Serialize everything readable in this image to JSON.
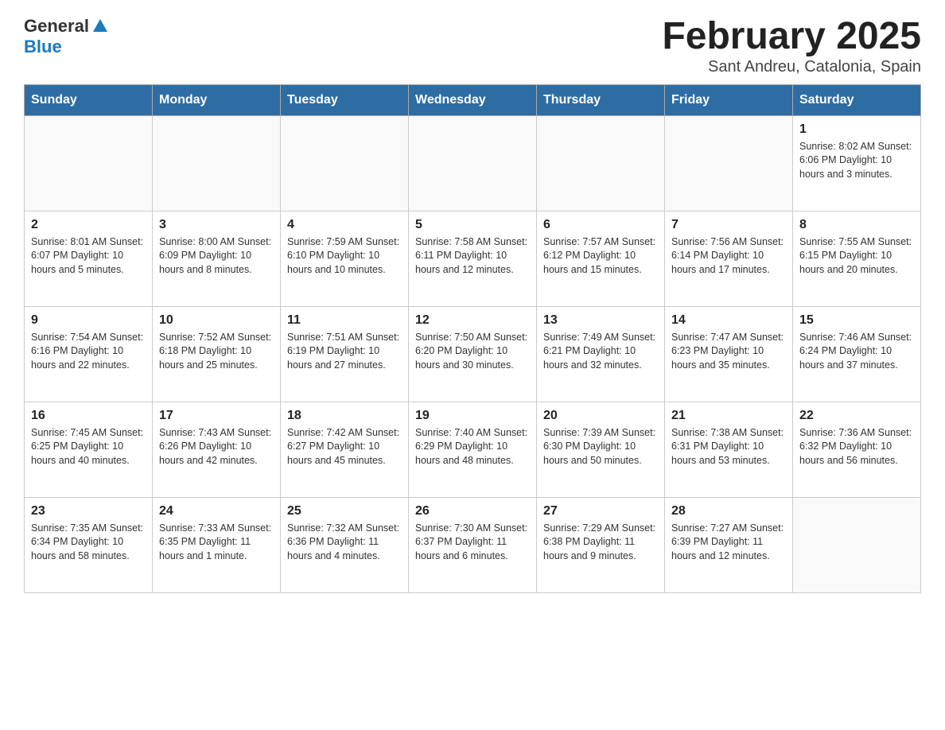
{
  "header": {
    "logo_general": "General",
    "logo_blue": "Blue",
    "title": "February 2025",
    "subtitle": "Sant Andreu, Catalonia, Spain"
  },
  "days_of_week": [
    "Sunday",
    "Monday",
    "Tuesday",
    "Wednesday",
    "Thursday",
    "Friday",
    "Saturday"
  ],
  "weeks": [
    [
      {
        "day": "",
        "info": ""
      },
      {
        "day": "",
        "info": ""
      },
      {
        "day": "",
        "info": ""
      },
      {
        "day": "",
        "info": ""
      },
      {
        "day": "",
        "info": ""
      },
      {
        "day": "",
        "info": ""
      },
      {
        "day": "1",
        "info": "Sunrise: 8:02 AM\nSunset: 6:06 PM\nDaylight: 10 hours\nand 3 minutes."
      }
    ],
    [
      {
        "day": "2",
        "info": "Sunrise: 8:01 AM\nSunset: 6:07 PM\nDaylight: 10 hours\nand 5 minutes."
      },
      {
        "day": "3",
        "info": "Sunrise: 8:00 AM\nSunset: 6:09 PM\nDaylight: 10 hours\nand 8 minutes."
      },
      {
        "day": "4",
        "info": "Sunrise: 7:59 AM\nSunset: 6:10 PM\nDaylight: 10 hours\nand 10 minutes."
      },
      {
        "day": "5",
        "info": "Sunrise: 7:58 AM\nSunset: 6:11 PM\nDaylight: 10 hours\nand 12 minutes."
      },
      {
        "day": "6",
        "info": "Sunrise: 7:57 AM\nSunset: 6:12 PM\nDaylight: 10 hours\nand 15 minutes."
      },
      {
        "day": "7",
        "info": "Sunrise: 7:56 AM\nSunset: 6:14 PM\nDaylight: 10 hours\nand 17 minutes."
      },
      {
        "day": "8",
        "info": "Sunrise: 7:55 AM\nSunset: 6:15 PM\nDaylight: 10 hours\nand 20 minutes."
      }
    ],
    [
      {
        "day": "9",
        "info": "Sunrise: 7:54 AM\nSunset: 6:16 PM\nDaylight: 10 hours\nand 22 minutes."
      },
      {
        "day": "10",
        "info": "Sunrise: 7:52 AM\nSunset: 6:18 PM\nDaylight: 10 hours\nand 25 minutes."
      },
      {
        "day": "11",
        "info": "Sunrise: 7:51 AM\nSunset: 6:19 PM\nDaylight: 10 hours\nand 27 minutes."
      },
      {
        "day": "12",
        "info": "Sunrise: 7:50 AM\nSunset: 6:20 PM\nDaylight: 10 hours\nand 30 minutes."
      },
      {
        "day": "13",
        "info": "Sunrise: 7:49 AM\nSunset: 6:21 PM\nDaylight: 10 hours\nand 32 minutes."
      },
      {
        "day": "14",
        "info": "Sunrise: 7:47 AM\nSunset: 6:23 PM\nDaylight: 10 hours\nand 35 minutes."
      },
      {
        "day": "15",
        "info": "Sunrise: 7:46 AM\nSunset: 6:24 PM\nDaylight: 10 hours\nand 37 minutes."
      }
    ],
    [
      {
        "day": "16",
        "info": "Sunrise: 7:45 AM\nSunset: 6:25 PM\nDaylight: 10 hours\nand 40 minutes."
      },
      {
        "day": "17",
        "info": "Sunrise: 7:43 AM\nSunset: 6:26 PM\nDaylight: 10 hours\nand 42 minutes."
      },
      {
        "day": "18",
        "info": "Sunrise: 7:42 AM\nSunset: 6:27 PM\nDaylight: 10 hours\nand 45 minutes."
      },
      {
        "day": "19",
        "info": "Sunrise: 7:40 AM\nSunset: 6:29 PM\nDaylight: 10 hours\nand 48 minutes."
      },
      {
        "day": "20",
        "info": "Sunrise: 7:39 AM\nSunset: 6:30 PM\nDaylight: 10 hours\nand 50 minutes."
      },
      {
        "day": "21",
        "info": "Sunrise: 7:38 AM\nSunset: 6:31 PM\nDaylight: 10 hours\nand 53 minutes."
      },
      {
        "day": "22",
        "info": "Sunrise: 7:36 AM\nSunset: 6:32 PM\nDaylight: 10 hours\nand 56 minutes."
      }
    ],
    [
      {
        "day": "23",
        "info": "Sunrise: 7:35 AM\nSunset: 6:34 PM\nDaylight: 10 hours\nand 58 minutes."
      },
      {
        "day": "24",
        "info": "Sunrise: 7:33 AM\nSunset: 6:35 PM\nDaylight: 11 hours\nand 1 minute."
      },
      {
        "day": "25",
        "info": "Sunrise: 7:32 AM\nSunset: 6:36 PM\nDaylight: 11 hours\nand 4 minutes."
      },
      {
        "day": "26",
        "info": "Sunrise: 7:30 AM\nSunset: 6:37 PM\nDaylight: 11 hours\nand 6 minutes."
      },
      {
        "day": "27",
        "info": "Sunrise: 7:29 AM\nSunset: 6:38 PM\nDaylight: 11 hours\nand 9 minutes."
      },
      {
        "day": "28",
        "info": "Sunrise: 7:27 AM\nSunset: 6:39 PM\nDaylight: 11 hours\nand 12 minutes."
      },
      {
        "day": "",
        "info": ""
      }
    ]
  ]
}
